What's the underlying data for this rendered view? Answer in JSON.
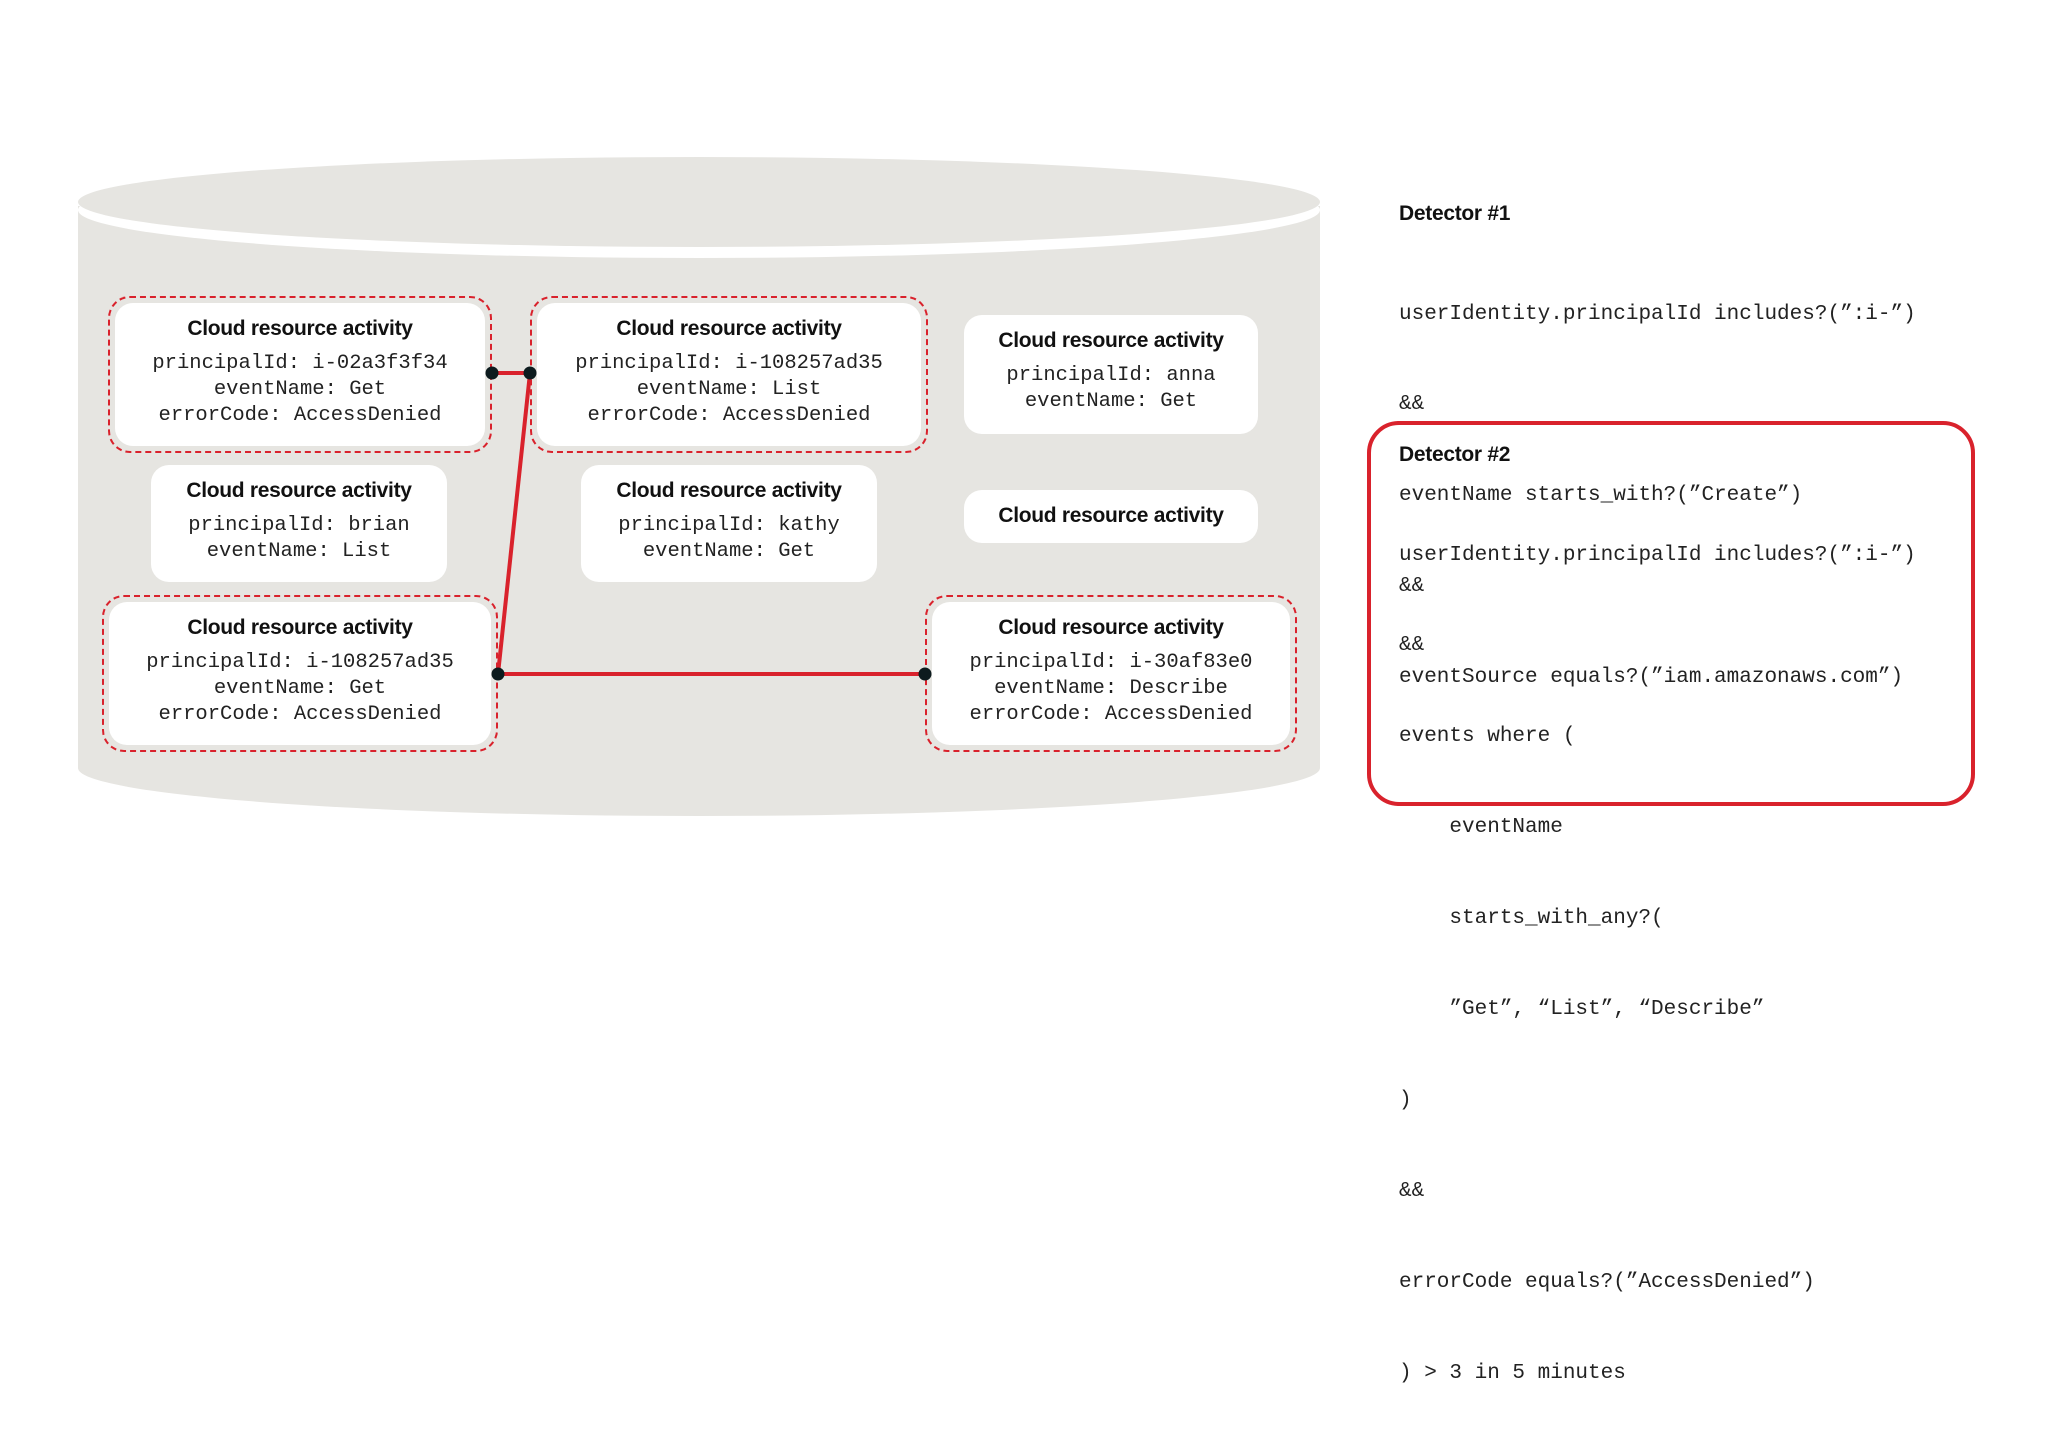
{
  "diagram": {
    "store_label": "",
    "colors": {
      "store_fill": "#e6e5e1",
      "card_fill": "#ffffff",
      "highlight": "#d9222c",
      "node": "#0d1b1e"
    },
    "cards": [
      {
        "id": "c1",
        "title": "Cloud resource activity",
        "lines": [
          "principalId: i-02a3f3f34",
          "eventName: Get",
          "errorCode: AccessDenied"
        ],
        "flagged": true
      },
      {
        "id": "c2",
        "title": "Cloud resource activity",
        "lines": [
          "principalId: i-108257ad35",
          "eventName: List",
          "errorCode: AccessDenied"
        ],
        "flagged": true
      },
      {
        "id": "c3",
        "title": "Cloud resource activity",
        "lines": [
          "principalId: anna",
          "eventName: Get"
        ],
        "flagged": false
      },
      {
        "id": "c4",
        "title": "Cloud resource activity",
        "lines": [
          "principalId: brian",
          "eventName: List"
        ],
        "flagged": false
      },
      {
        "id": "c5",
        "title": "Cloud resource activity",
        "lines": [
          "principalId: kathy",
          "eventName: Get"
        ],
        "flagged": false
      },
      {
        "id": "c6",
        "title": "Cloud resource activity",
        "lines": [],
        "flagged": false
      },
      {
        "id": "c7",
        "title": "Cloud resource activity",
        "lines": [
          "principalId: i-108257ad35",
          "eventName: Get",
          "errorCode: AccessDenied"
        ],
        "flagged": true
      },
      {
        "id": "c8",
        "title": "Cloud resource activity",
        "lines": [
          "principalId: i-30af83e0",
          "eventName: Describe",
          "errorCode: AccessDenied"
        ],
        "flagged": true
      }
    ],
    "links": [
      {
        "from": "c1",
        "to": "c2"
      },
      {
        "from": "c2",
        "to": "c7"
      },
      {
        "from": "c7",
        "to": "c8"
      }
    ]
  },
  "detectors": [
    {
      "title": "Detector #1",
      "highlighted": false,
      "code": [
        "userIdentity.principalId includes?(”:i-”)",
        "&&",
        "eventName starts_with?(”Create”)",
        "&&",
        "eventSource equals?(”iam.amazonaws.com”)"
      ]
    },
    {
      "title": "Detector #2",
      "highlighted": true,
      "code": [
        "userIdentity.principalId includes?(”:i-”)",
        "&&",
        "events where (",
        "    eventName",
        "    starts_with_any?(",
        "    ”Get”, “List”, “Describe”",
        ")",
        "&&",
        "errorCode equals?(”AccessDenied”)",
        ") > 3 in 5 minutes"
      ]
    }
  ]
}
